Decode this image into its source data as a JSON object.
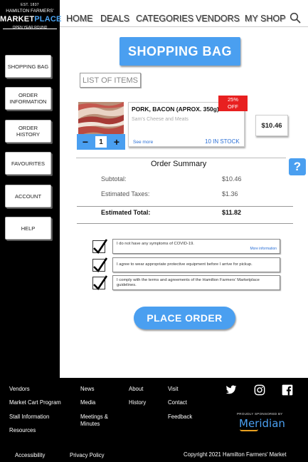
{
  "sidebar": {
    "logo": {
      "est": "EST. 1837",
      "org": "HAMILTON FARMERS'",
      "market": "MARKET",
      "place": "PLACE",
      "tagline": "OPEN YEAR ROUND"
    },
    "buttons": [
      {
        "label": "SHOPPING BAG"
      },
      {
        "label": "ORDER INFORMATION"
      },
      {
        "label": "ORDER HISTORY"
      },
      {
        "label": "FAVOURITES"
      },
      {
        "label": "ACCOUNT"
      },
      {
        "label": "HELP"
      }
    ]
  },
  "topnav": {
    "items": [
      "HOME",
      "DEALS",
      "CATEGORIES",
      "VENDORS",
      "MY SHOP"
    ],
    "search_icon": "search-icon"
  },
  "main": {
    "title": "SHOPPING BAG",
    "list_label": "LIST OF ITEMS",
    "item": {
      "name": "PORK, BACON (APROX. 350g)",
      "vendor": "Sam's Cheese and Meats",
      "see_more": "See more",
      "stock": "10 IN STOCK",
      "discount_line1": "25%",
      "discount_line2": "OFF",
      "price": "$10.46",
      "quantity": "1",
      "minus": "−",
      "plus": "+"
    },
    "summary": {
      "title": "Order Summary",
      "subtotal_label": "Subtotal:",
      "subtotal_value": "$10.46",
      "taxes_label": "Estimated Taxes:",
      "taxes_value": "$1.36",
      "total_label": "Estimated Total:",
      "total_value": "$11.82"
    },
    "help_label": "?",
    "agreements": [
      {
        "text": "I do not have any symptoms of COVID-19.",
        "more": "More information",
        "checked": true
      },
      {
        "text": "I agree to wear appropriate protective equipment before I arrive for pickup.",
        "checked": true
      },
      {
        "text": "I comply with the terms and agreements of the Hamilton Farmers' Marketplace guidelines.",
        "checked": true
      }
    ],
    "place_order": "PLACE ORDER"
  },
  "footer": {
    "col1": [
      "Vendors",
      "Market Cart Program",
      "Stall Information",
      "Resources"
    ],
    "col2": [
      "News",
      "Media",
      "Meetings & Minutes"
    ],
    "col3": [
      "About",
      "History"
    ],
    "col4": [
      "Visit",
      "Contact",
      "Feedback"
    ],
    "social": [
      "twitter-icon",
      "instagram-icon",
      "facebook-icon"
    ],
    "sponsor_label": "PROUDLY SPONSORED BY",
    "sponsor_name": "Meridian",
    "bottom_links": [
      "Accessibility",
      "Privacy Policy"
    ],
    "copyright": "Copyright 2021 Hamilton Farmers' Market"
  },
  "colors": {
    "accent": "#4a9ff0",
    "discount": "#e82020",
    "link": "#2a6fd6"
  }
}
